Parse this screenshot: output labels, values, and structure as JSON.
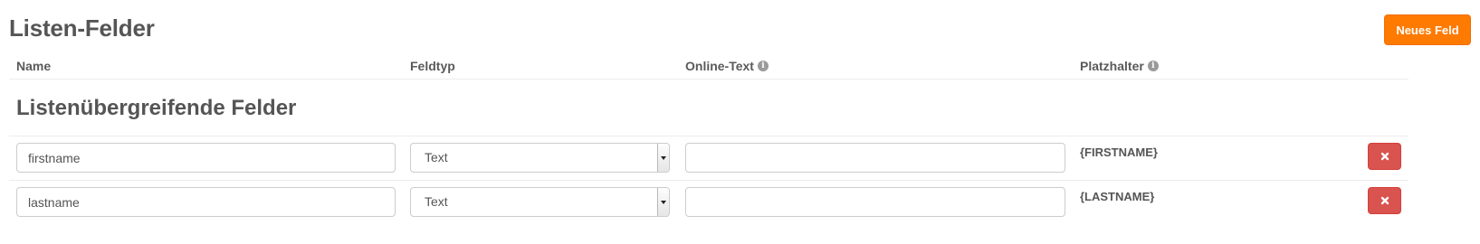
{
  "header": {
    "title": "Listen-Felder",
    "new_field_label": "Neues Feld"
  },
  "columns": {
    "name": "Name",
    "field_type": "Feldtyp",
    "online_text": "Online-Text",
    "placeholder": "Platzhalter",
    "info_glyph": "i"
  },
  "section": {
    "title": "Listenübergreifende Felder"
  },
  "rows": [
    {
      "name": "firstname",
      "field_type": "Text",
      "online_text": "",
      "placeholder": "{FIRSTNAME}"
    },
    {
      "name": "lastname",
      "field_type": "Text",
      "online_text": "",
      "placeholder": "{LASTNAME}"
    }
  ],
  "icons": {
    "info": "info-circle-icon",
    "delete": "times-icon",
    "dropdown": "caret-down-icon"
  },
  "colors": {
    "primary_button": "#ff7a00",
    "danger_button": "#d9534f",
    "text": "#555555"
  }
}
